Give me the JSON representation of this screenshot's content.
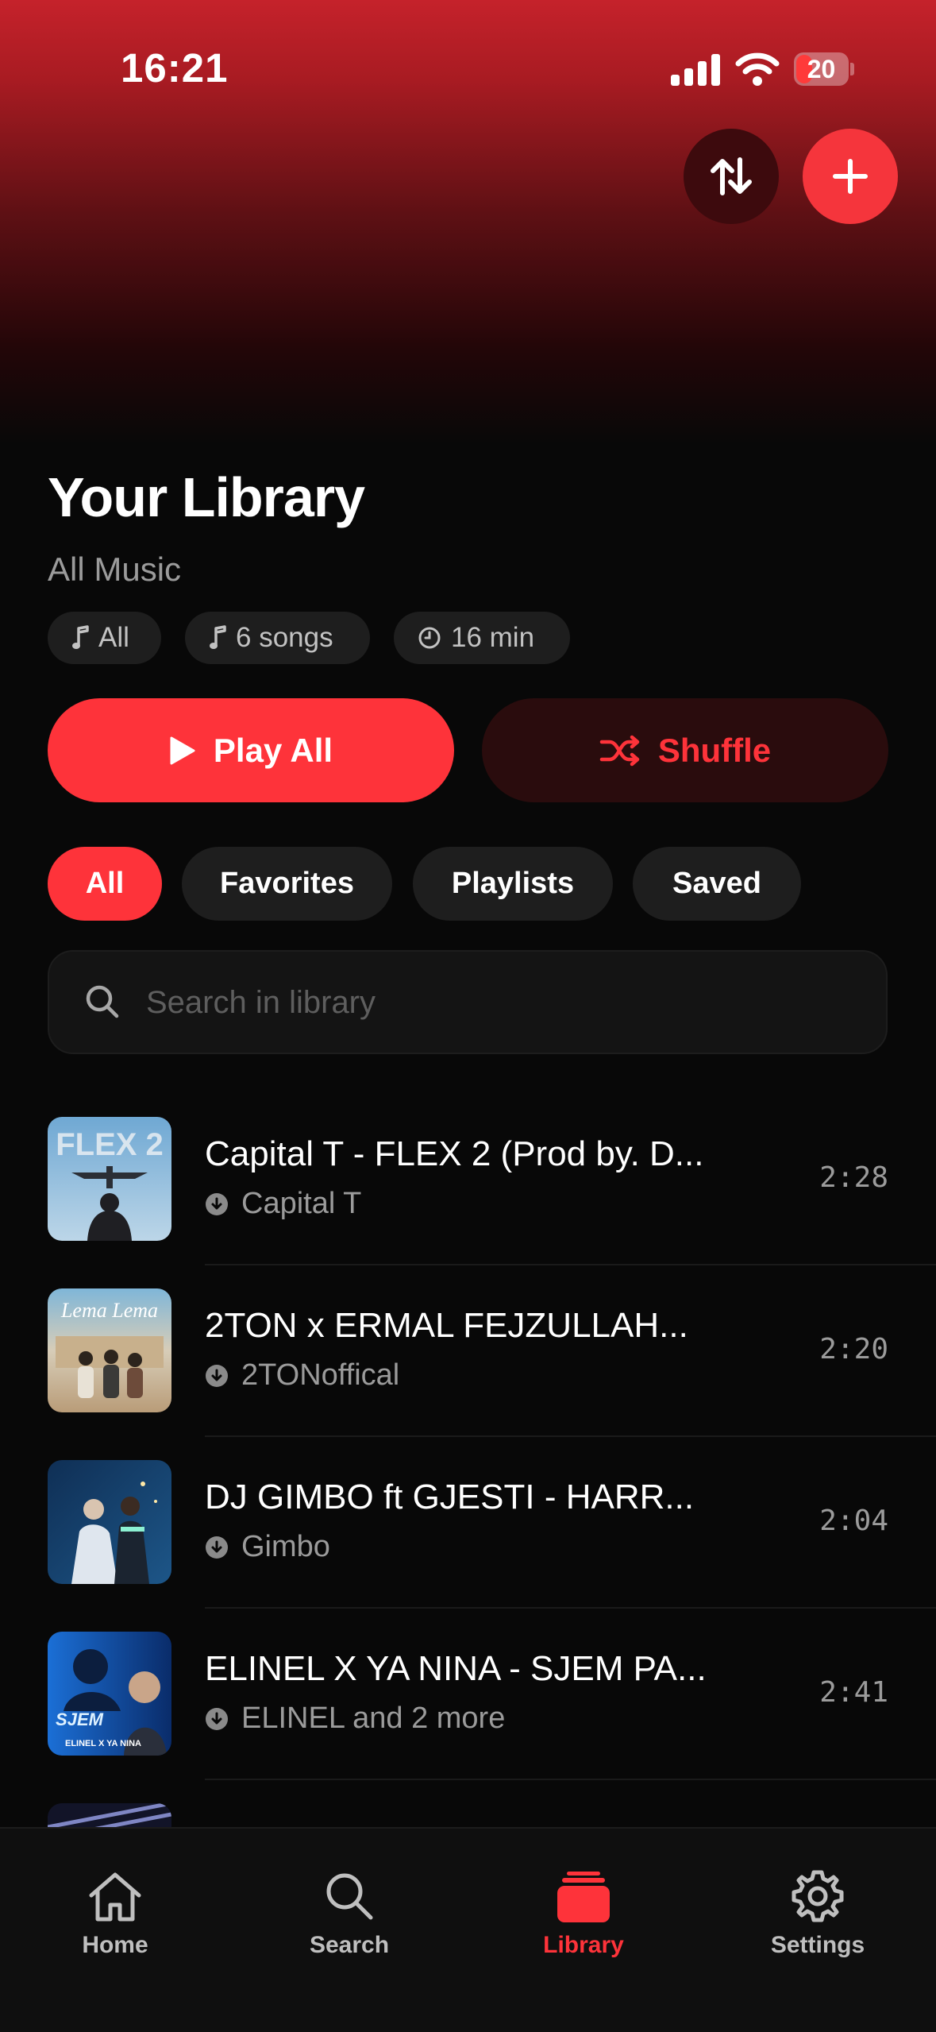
{
  "status_bar": {
    "time": "16:21",
    "battery": "20"
  },
  "header": {
    "title": "Your Library",
    "subtitle": "All Music"
  },
  "stats": {
    "all": "All",
    "songs": "6 songs",
    "duration": "16 min"
  },
  "actions": {
    "play_all": "Play All",
    "shuffle": "Shuffle"
  },
  "filters": [
    "All",
    "Favorites",
    "Playlists",
    "Saved"
  ],
  "active_filter": "All",
  "search": {
    "placeholder": "Search in library",
    "value": ""
  },
  "tracks": [
    {
      "title": "Capital T - FLEX 2 (Prod by. D...",
      "artist": "Capital T",
      "duration": "2:28"
    },
    {
      "title": "2TON x ERMAL FEJZULLAH...",
      "artist": "2TONoffical",
      "duration": "2:20"
    },
    {
      "title": "DJ GIMBO ft GJESTI - HARR...",
      "artist": "Gimbo",
      "duration": "2:04"
    },
    {
      "title": "ELINEL X YA NINA - SJEM PA...",
      "artist": "ELINEL and 2 more",
      "duration": "2:41"
    }
  ],
  "tab_bar": {
    "home": "Home",
    "search": "Search",
    "library": "Library",
    "settings": "Settings",
    "active": "Library"
  },
  "colors": {
    "accent": "#fe333a",
    "background": "#080808",
    "surface": "#1e1e1e",
    "muted_text": "#9b9b9b"
  }
}
